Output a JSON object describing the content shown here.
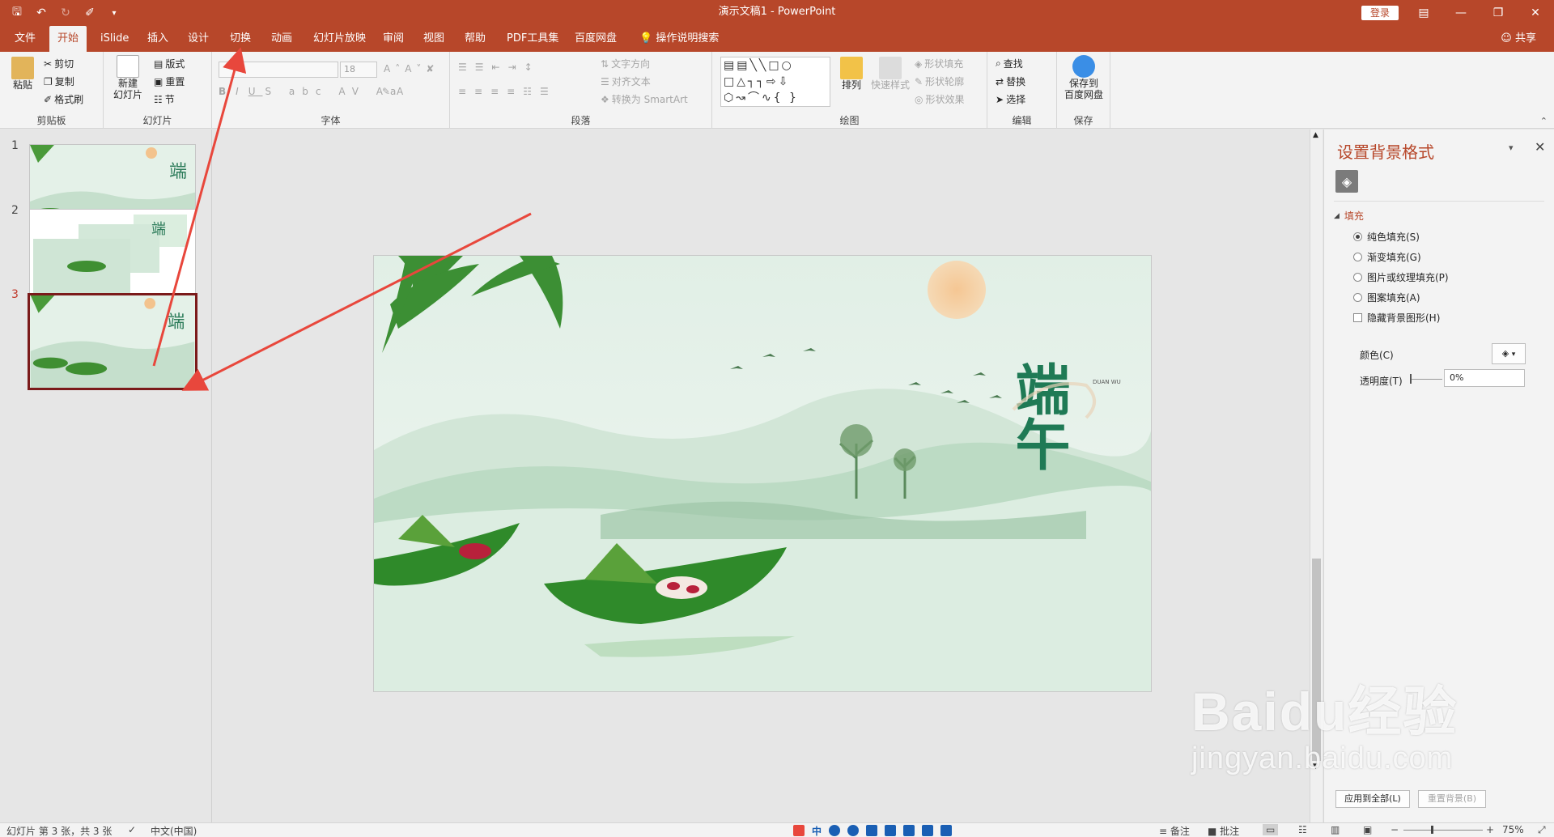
{
  "window": {
    "title": "演示文稿1  -  PowerPoint",
    "login_label": "登录",
    "quick_access": [
      "save-icon",
      "undo-icon",
      "redo-icon",
      "format-painter-icon",
      "customize-icon"
    ]
  },
  "tabs": [
    "文件",
    "开始",
    "iSlide",
    "插入",
    "设计",
    "切换",
    "动画",
    "幻灯片放映",
    "审阅",
    "视图",
    "帮助",
    "PDF工具集",
    "百度网盘",
    "操作说明搜索"
  ],
  "active_tab": "开始",
  "share_label": "共享",
  "ribbon": {
    "clipboard": {
      "paste": "粘贴",
      "cut": "剪切",
      "copy": "复制",
      "format_painter": "格式刷",
      "label": "剪贴板"
    },
    "slides": {
      "new_slide": "新建\n幻灯片",
      "layout": "版式",
      "reset": "重置",
      "section": "节",
      "label": "幻灯片"
    },
    "font": {
      "size": "18",
      "label": "字体"
    },
    "paragraph": {
      "text_direction": "文字方向",
      "align_text": "对齐文本",
      "smartart": "转换为 SmartArt",
      "label": "段落"
    },
    "drawing": {
      "arrange": "排列",
      "quick_styles": "快速样式",
      "shape_fill": "形状填充",
      "shape_outline": "形状轮廓",
      "shape_effects": "形状效果",
      "label": "绘图"
    },
    "editing": {
      "find": "查找",
      "replace": "替换",
      "select": "选择",
      "label": "编辑"
    },
    "save": {
      "save_to_baidu": "保存到\n百度网盘",
      "label": "保存"
    }
  },
  "slides": [
    {
      "number": "1",
      "selected": false
    },
    {
      "number": "2",
      "selected": false
    },
    {
      "number": "3",
      "selected": true
    }
  ],
  "slide_content": {
    "title_art": "端午",
    "subtitle_art": "DUAN WU"
  },
  "format_pane": {
    "title": "设置背景格式",
    "section": "填充",
    "options": [
      {
        "label": "纯色填充(S)",
        "type": "radio",
        "checked": true
      },
      {
        "label": "渐变填充(G)",
        "type": "radio",
        "checked": false
      },
      {
        "label": "图片或纹理填充(P)",
        "type": "radio",
        "checked": false
      },
      {
        "label": "图案填充(A)",
        "type": "radio",
        "checked": false
      },
      {
        "label": "隐藏背景图形(H)",
        "type": "checkbox",
        "checked": false
      }
    ],
    "color_label": "颜色(C)",
    "transparency_label": "透明度(T)",
    "transparency_value": "0%",
    "apply_all": "应用到全部(L)",
    "reset_bg": "重置背景(B)"
  },
  "status": {
    "slide_info": "幻灯片 第 3 张，共 3 张",
    "language": "中文(中国)",
    "notes": "备注",
    "comments": "批注",
    "zoom": "75%"
  },
  "watermark": {
    "main": "Baidu经验",
    "url": "jingyan.baidu.com"
  },
  "colors": {
    "accent": "#b7472a",
    "arrow": "#e8473c",
    "selected_border": "#7b1a1a"
  }
}
